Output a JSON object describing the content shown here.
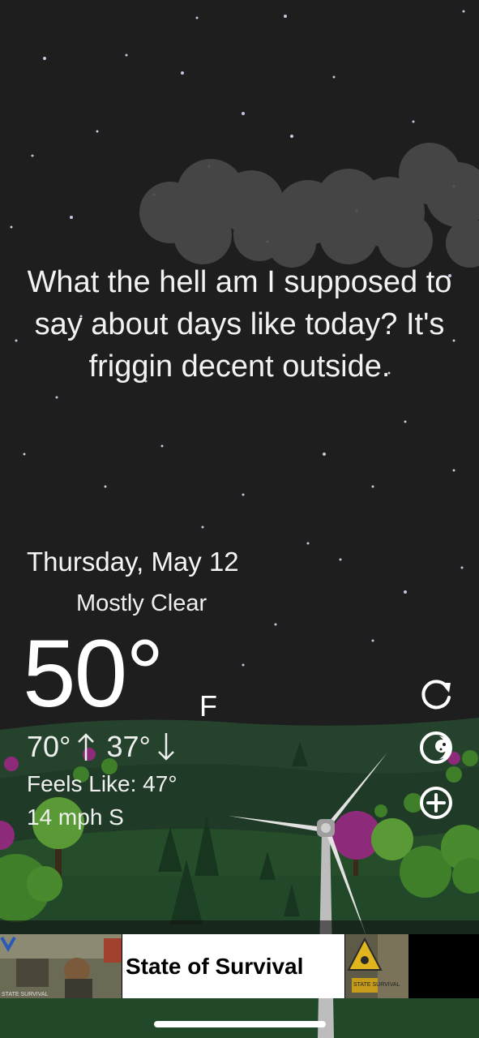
{
  "forecast": {
    "message": "What the hell am I supposed to say about days like today? It's friggin decent outside.",
    "date": "Thursday, May 12",
    "condition": "Mostly Clear",
    "condition_icon": "crescent-moon-icon",
    "temperature": "50°",
    "unit": "F",
    "high": "70°",
    "low": "37°",
    "feels_like": "Feels Like: 47°",
    "wind": "14 mph S"
  },
  "controls": {
    "refresh_icon": "refresh-icon",
    "theme_icon": "moon-theme-icon",
    "add_icon": "add-location-icon"
  },
  "ad": {
    "text": "State of Survival",
    "thumb_left_caption": "STATE SURVIVAL",
    "thumb_right_caption": "STATE SURVIVAL"
  },
  "colors": {
    "sky": "#1e1e1e",
    "moon": "#4a7fe0",
    "ground": "#1d3a22",
    "tree_purple": "#8e2a7a",
    "tree_green": "#4a8a2e"
  }
}
